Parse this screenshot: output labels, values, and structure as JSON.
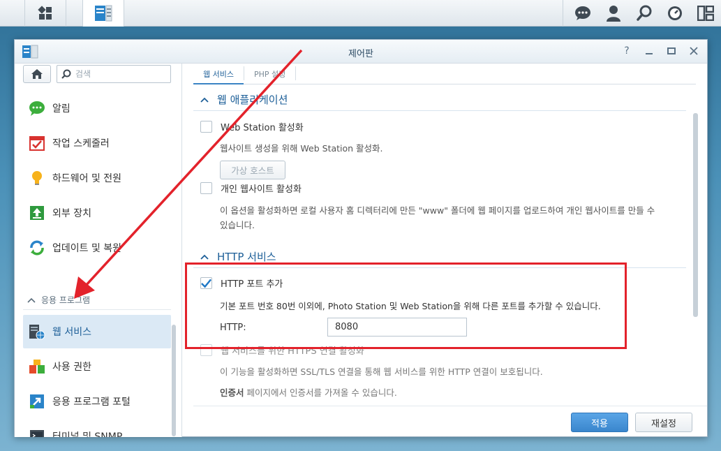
{
  "window": {
    "title": "제어판",
    "controls": [
      "help-icon",
      "minimize-icon",
      "maximize-icon",
      "close-icon"
    ]
  },
  "taskbar": {
    "left": [
      "main-menu-icon",
      "control-panel-icon"
    ],
    "right": [
      "notification-icon",
      "user-icon",
      "search-icon",
      "widget-icon",
      "pilot-view-icon"
    ]
  },
  "sidebar": {
    "search_placeholder": "검색",
    "items": [
      {
        "label": "알림",
        "icon": "chat-icon"
      },
      {
        "label": "작업 스케줄러",
        "icon": "calendar-check-icon"
      },
      {
        "label": "하드웨어 및 전원",
        "icon": "lightbulb-icon"
      },
      {
        "label": "외부 장치",
        "icon": "upload-icon"
      },
      {
        "label": "업데이트 및 복원",
        "icon": "refresh-icon"
      }
    ],
    "section_label": "응용 프로그램",
    "app_items": [
      {
        "label": "웹 서비스",
        "icon": "web-service-icon",
        "active": true
      },
      {
        "label": "사용 권한",
        "icon": "permission-icon"
      },
      {
        "label": "응용 프로그램 포털",
        "icon": "portal-icon"
      },
      {
        "label": "터미널 및 SNMP",
        "icon": "terminal-icon"
      }
    ]
  },
  "tabs": [
    {
      "label": "웹 서비스",
      "active": true
    },
    {
      "label": "PHP 설정",
      "active": false
    }
  ],
  "web_app": {
    "title": "웹 애플리케이션",
    "web_station_label": "Web Station 활성화",
    "web_station_desc": "웹사이트 생성을 위해 Web Station 활성화.",
    "virtual_host_button": "가상 호스트",
    "personal_site_label": "개인 웹사이트 활성화",
    "personal_site_desc_1": "이 옵션을 활성화하면 로컬 사용자 홈 디렉터리에 만든 \"www\" 폴더에 웹 페이지를 업로드하여 개인 웹사이트를 만들 수",
    "personal_site_desc_2": "있습니다."
  },
  "http": {
    "title": "HTTP 서비스",
    "add_port_label": "HTTP 포트 추가",
    "add_port_checked": true,
    "add_port_desc": "기본 포트 번호 80번 이외에, Photo Station 및 Web Station을 위해 다른 포트를 추가할 수 있습니다.",
    "port_field_label": "HTTP:",
    "port_value": "8080",
    "https_label": "웹 서비스를 위한 HTTPS 연결 활성화",
    "https_desc": "이 기능을 활성화하면 SSL/TLS 연결을 통해 웹 서비스를 위한 HTTP 연결이 보호됩니다.",
    "cert_link": "인증서",
    "cert_desc": " 페이지에서 인증서를 가져올 수 있습니다."
  },
  "footer": {
    "apply": "적용",
    "reset": "재설정"
  },
  "colors": {
    "accent": "#3b84c4",
    "annotation": "#e3222b"
  }
}
